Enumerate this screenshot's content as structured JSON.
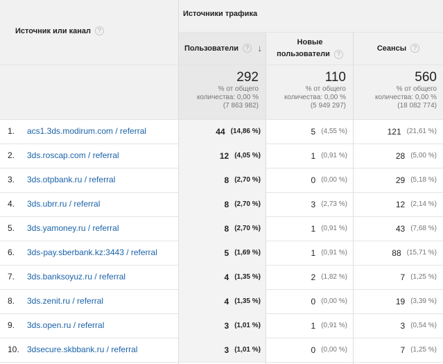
{
  "header": {
    "source_label": "Источник или канал",
    "group_label": "Источники трафика",
    "help_glyph": "?",
    "columns": {
      "users": "Пользователи",
      "new_line1": "Новые",
      "new_line2": "пользователи",
      "sessions": "Сеансы"
    },
    "sort_icon": "arrow-down-icon"
  },
  "totals": {
    "users": {
      "value": "292",
      "line1": "% от общего",
      "line2": "количества: 0,00 %",
      "line3": "(7 863 982)"
    },
    "new": {
      "value": "110",
      "line1": "% от общего",
      "line2": "количества: 0,00 %",
      "line3": "(5 949 297)"
    },
    "sessions": {
      "value": "560",
      "line1": "% от общего",
      "line2": "количества: 0,00 %",
      "line3": "(18 082 774)"
    }
  },
  "rows": [
    {
      "n": "1.",
      "source": "acs1.3ds.modirum.com / referral",
      "users": "44",
      "users_pct": "(14,86 %)",
      "new": "5",
      "new_pct": "(4,55 %)",
      "sessions": "121",
      "sessions_pct": "(21,61 %)"
    },
    {
      "n": "2.",
      "source": "3ds.roscap.com / referral",
      "users": "12",
      "users_pct": "(4,05 %)",
      "new": "1",
      "new_pct": "(0,91 %)",
      "sessions": "28",
      "sessions_pct": "(5,00 %)"
    },
    {
      "n": "3.",
      "source": "3ds.otpbank.ru / referral",
      "users": "8",
      "users_pct": "(2,70 %)",
      "new": "0",
      "new_pct": "(0,00 %)",
      "sessions": "29",
      "sessions_pct": "(5,18 %)"
    },
    {
      "n": "4.",
      "source": "3ds.ubrr.ru / referral",
      "users": "8",
      "users_pct": "(2,70 %)",
      "new": "3",
      "new_pct": "(2,73 %)",
      "sessions": "12",
      "sessions_pct": "(2,14 %)"
    },
    {
      "n": "5.",
      "source": "3ds.yamoney.ru / referral",
      "users": "8",
      "users_pct": "(2,70 %)",
      "new": "1",
      "new_pct": "(0,91 %)",
      "sessions": "43",
      "sessions_pct": "(7,68 %)"
    },
    {
      "n": "6.",
      "source": "3ds-pay.sberbank.kz:3443 / referral",
      "users": "5",
      "users_pct": "(1,69 %)",
      "new": "1",
      "new_pct": "(0,91 %)",
      "sessions": "88",
      "sessions_pct": "(15,71 %)"
    },
    {
      "n": "7.",
      "source": "3ds.banksoyuz.ru / referral",
      "users": "4",
      "users_pct": "(1,35 %)",
      "new": "2",
      "new_pct": "(1,82 %)",
      "sessions": "7",
      "sessions_pct": "(1,25 %)"
    },
    {
      "n": "8.",
      "source": "3ds.zenit.ru / referral",
      "users": "4",
      "users_pct": "(1,35 %)",
      "new": "0",
      "new_pct": "(0,00 %)",
      "sessions": "19",
      "sessions_pct": "(3,39 %)"
    },
    {
      "n": "9.",
      "source": "3ds.open.ru / referral",
      "users": "3",
      "users_pct": "(1,01 %)",
      "new": "1",
      "new_pct": "(0,91 %)",
      "sessions": "3",
      "sessions_pct": "(0,54 %)"
    },
    {
      "n": "10.",
      "source": "3dsecure.skbbank.ru / referral",
      "users": "3",
      "users_pct": "(1,01 %)",
      "new": "0",
      "new_pct": "(0,00 %)",
      "sessions": "7",
      "sessions_pct": "(1,25 %)"
    }
  ]
}
